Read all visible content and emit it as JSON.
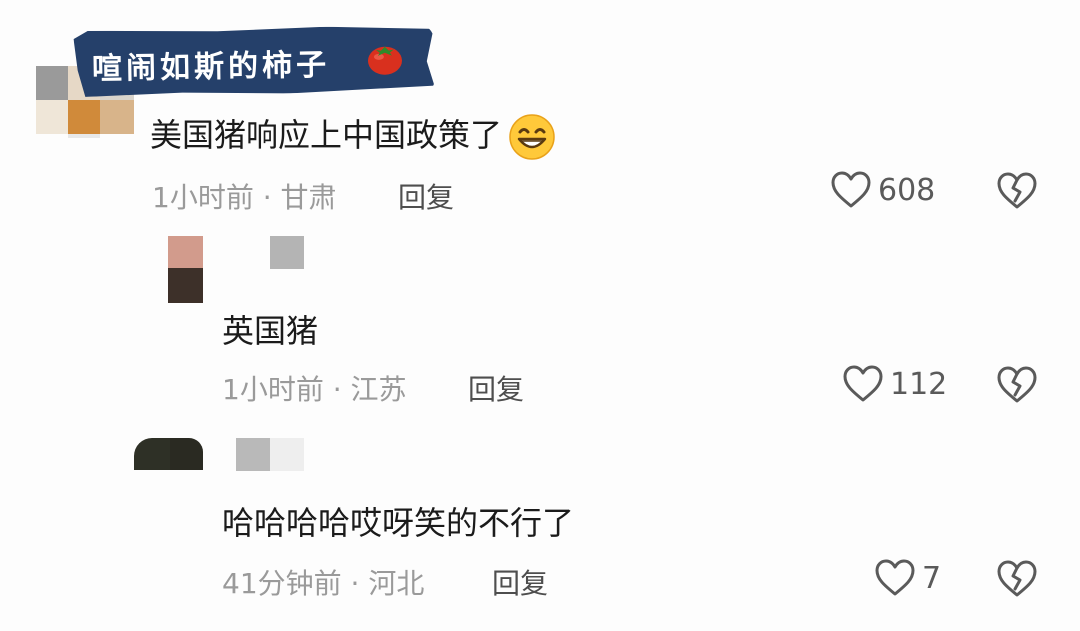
{
  "watermark": {
    "text": "喧闹如斯的柿子",
    "emoji": "tomato-icon"
  },
  "comments": [
    {
      "text": "美国猪响应上中国政策了",
      "emoji": "grinning-face-icon",
      "time": "1小时前",
      "location": "甘肃",
      "reply_label": "回复",
      "likes": "608"
    },
    {
      "text": "英国猪",
      "time": "1小时前",
      "location": "江苏",
      "reply_label": "回复",
      "likes": "112"
    },
    {
      "text": "哈哈哈哈哎呀笑的不行了",
      "time": "41分钟前",
      "location": "河北",
      "reply_label": "回复",
      "likes": "7"
    }
  ],
  "separator": " · ",
  "colors": {
    "badge": "#25406a",
    "text": "#1b1b1b",
    "meta": "#9a9a9a",
    "icon": "#5a5a5a"
  }
}
